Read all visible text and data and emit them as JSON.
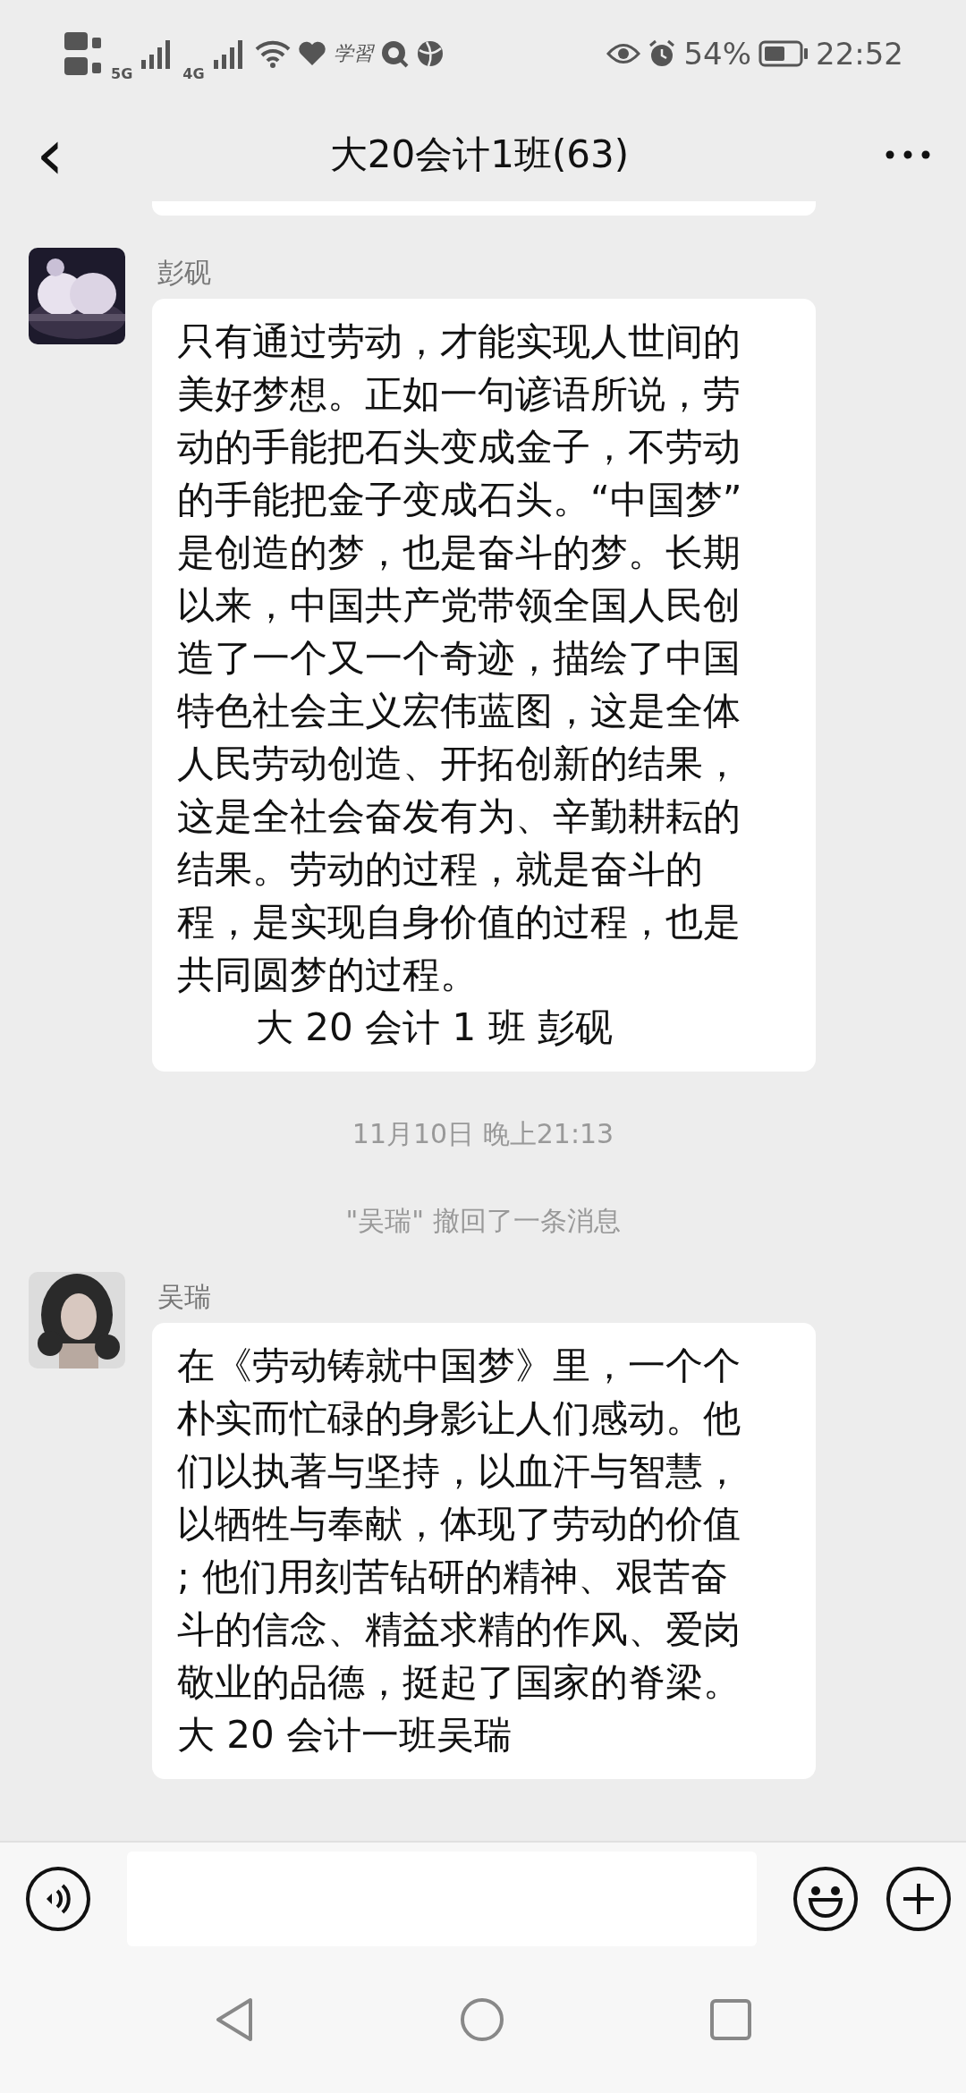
{
  "status_bar": {
    "network_labels": [
      "5G",
      "4G"
    ],
    "app_label": "学習",
    "battery": "54%",
    "time": "22:52"
  },
  "header": {
    "back": "‹",
    "title": "大20会计1班(63)"
  },
  "messages": [
    {
      "kind": "text",
      "sender": "彭砚",
      "lines": [
        "只有通过劳动，才能实现人世间的",
        "美好梦想。正如一句谚语所说，劳",
        "动的手能把石头变成金子，不劳动",
        "的手能把金子变成石头。“中国梦”",
        "是创造的梦，也是奋斗的梦。长期",
        "以来，中国共产党带领全国人民创",
        "造了一个又一个奇迹，描绘了中国",
        "特色社会主义宏伟蓝图，这是全体",
        "人民劳动创造、开拓创新的结果，",
        "这是全社会奋发有为、辛勤耕耘的",
        "结果。劳动的过程，就是奋斗的",
        "程，是实现自身价值的过程，也是",
        "共同圆梦的过程。"
      ],
      "signature": "大 20 会计 1 班 彭砚"
    },
    {
      "kind": "time",
      "text": "11月10日 晚上21:13"
    },
    {
      "kind": "notice",
      "text": "\"吴瑞\" 撤回了一条消息"
    },
    {
      "kind": "text",
      "sender": "吴瑞",
      "lines": [
        "在《劳动铸就中国梦》里，一个个",
        "朴实而忙碌的身影让人们感动。他",
        "们以执著与坚持，以血汗与智慧，",
        "以牺牲与奉献，体现了劳动的价值",
        "; 他们用刻苦钻研的精神、艰苦奋",
        "斗的信念、精益求精的作风、爱岗",
        "敬业的品德，挺起了国家的脊梁。",
        "大 20 会计一班吴瑞"
      ]
    }
  ]
}
